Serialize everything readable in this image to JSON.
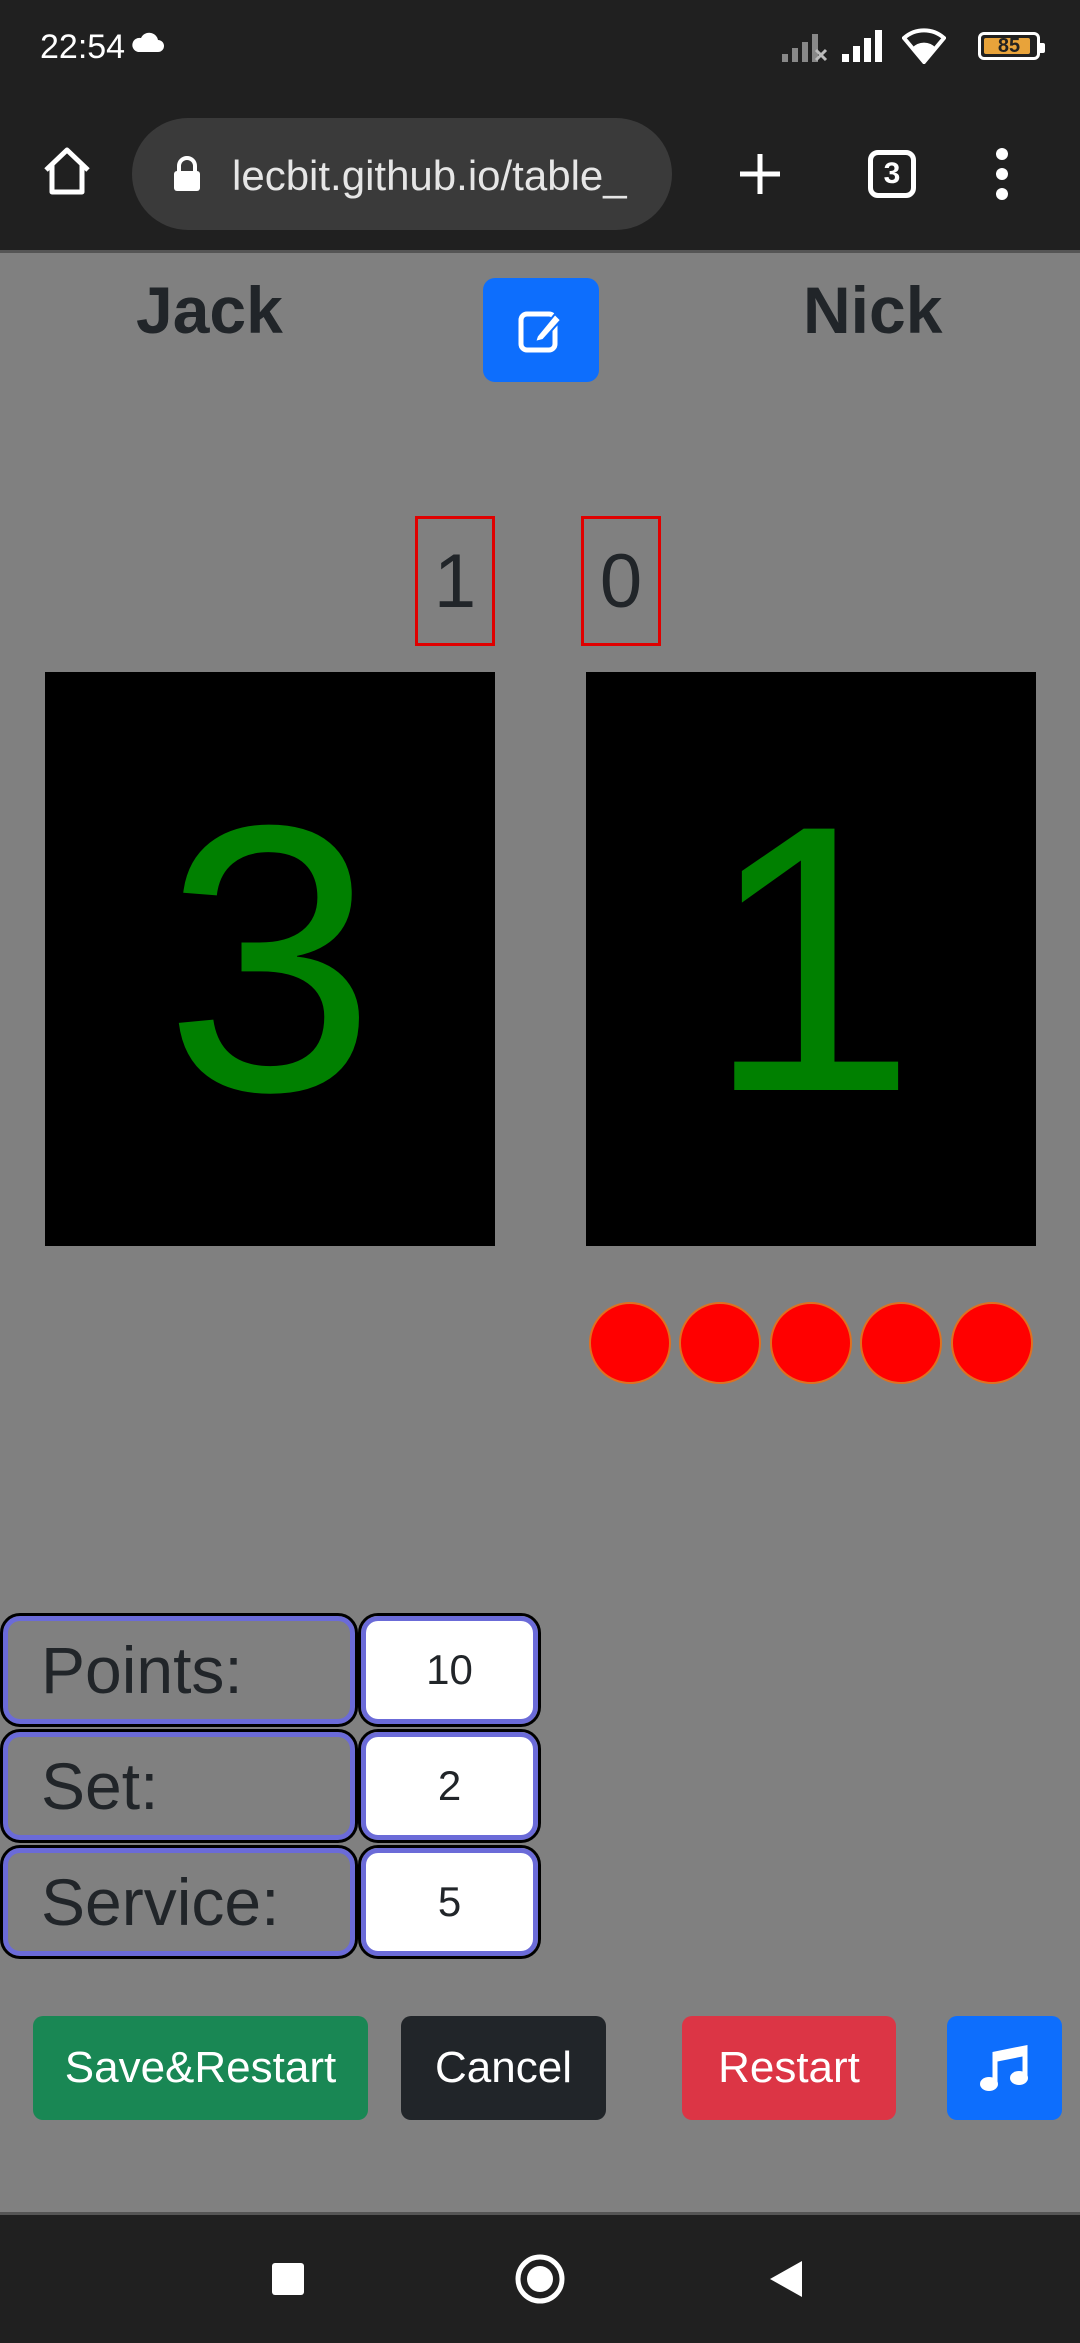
{
  "status": {
    "time": "22:54",
    "battery": "85"
  },
  "browser": {
    "url": "lecbit.github.io/table_",
    "tab_count": "3"
  },
  "players": {
    "left": "Jack",
    "right": "Nick"
  },
  "sets": {
    "left": "1",
    "right": "0"
  },
  "scores": {
    "left": "3",
    "right": "1"
  },
  "service_dots": 5,
  "config": {
    "points_label": "Points:",
    "points_value": "10",
    "set_label": "Set:",
    "set_value": "2",
    "service_label": "Service:",
    "service_value": "5"
  },
  "buttons": {
    "save": "Save&Restart",
    "cancel": "Cancel",
    "restart": "Restart"
  },
  "colors": {
    "accent": "#0d6efd",
    "save": "#198754",
    "cancel": "#212529",
    "restart": "#dc3545",
    "score": "#008000"
  }
}
